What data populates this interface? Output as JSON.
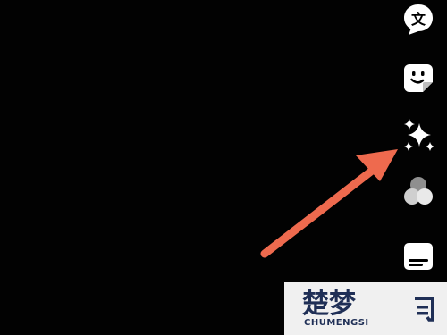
{
  "editor": {
    "toolbar": {
      "items": [
        {
          "id": "text",
          "icon": "text-translate-icon",
          "glyph": "文"
        },
        {
          "id": "sticker",
          "icon": "sticker-icon"
        },
        {
          "id": "effects",
          "icon": "sparkles-icon"
        },
        {
          "id": "filters",
          "icon": "filters-icon"
        },
        {
          "id": "captions",
          "icon": "captions-icon"
        }
      ]
    },
    "annotation": {
      "arrow_color": "#ee6a4e",
      "points_to": "effects"
    }
  },
  "watermark": {
    "logo_text": "楚梦",
    "latin_text": "CHUMENGSI",
    "colors": {
      "primary": "#1f2f56",
      "background": "#f0f0f0"
    }
  }
}
